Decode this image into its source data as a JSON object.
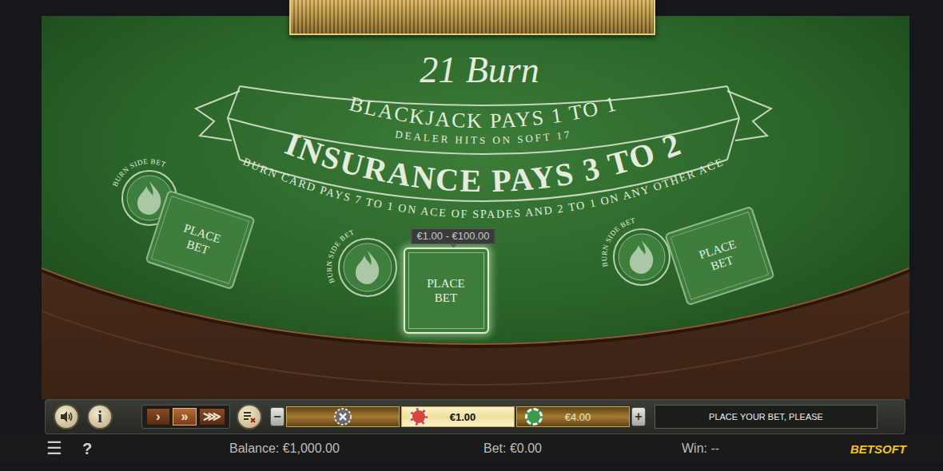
{
  "table": {
    "title": "21 Burn",
    "blackjack": "BLACKJACK PAYS 1 TO 1",
    "dealer_rule": "DEALER HITS ON SOFT 17",
    "insurance": "INSURANCE PAYS 3 TO 2",
    "burn_rule": "BURN CARD PAYS 7 TO 1 ON ACE OF SPADES AND 2 TO 1 ON ANY OTHER ACE"
  },
  "seats": [
    {
      "side_bet": "BURN SIDE BET",
      "bet": "PLACE BET",
      "selected": false
    },
    {
      "side_bet": "BURN SIDE BET",
      "bet": "PLACE BET",
      "selected": true
    },
    {
      "side_bet": "BURN SIDE BET",
      "bet": "PLACE BET",
      "selected": false
    }
  ],
  "bet_limits": "€1.00 - €100.00",
  "toolbar": {
    "info": "i",
    "speeds": [
      {
        "label": "›",
        "selected": false
      },
      {
        "label": "»",
        "selected": true
      },
      {
        "label": "⋙",
        "selected": false
      }
    ],
    "minus": "−",
    "plus": "+",
    "chips": [
      {
        "label": "€1.00",
        "selected": true,
        "color": "#d8453a"
      },
      {
        "label": "€4.00",
        "selected": false,
        "color": "#3c9a4a"
      }
    ],
    "message": "PLACE YOUR BET, PLEASE"
  },
  "status_bar": {
    "menu": "☰",
    "help": "?",
    "balance": "Balance: €1,000.00",
    "bet": "Bet: €0.00",
    "win": "Win: --",
    "logo": "BETSOFT"
  }
}
